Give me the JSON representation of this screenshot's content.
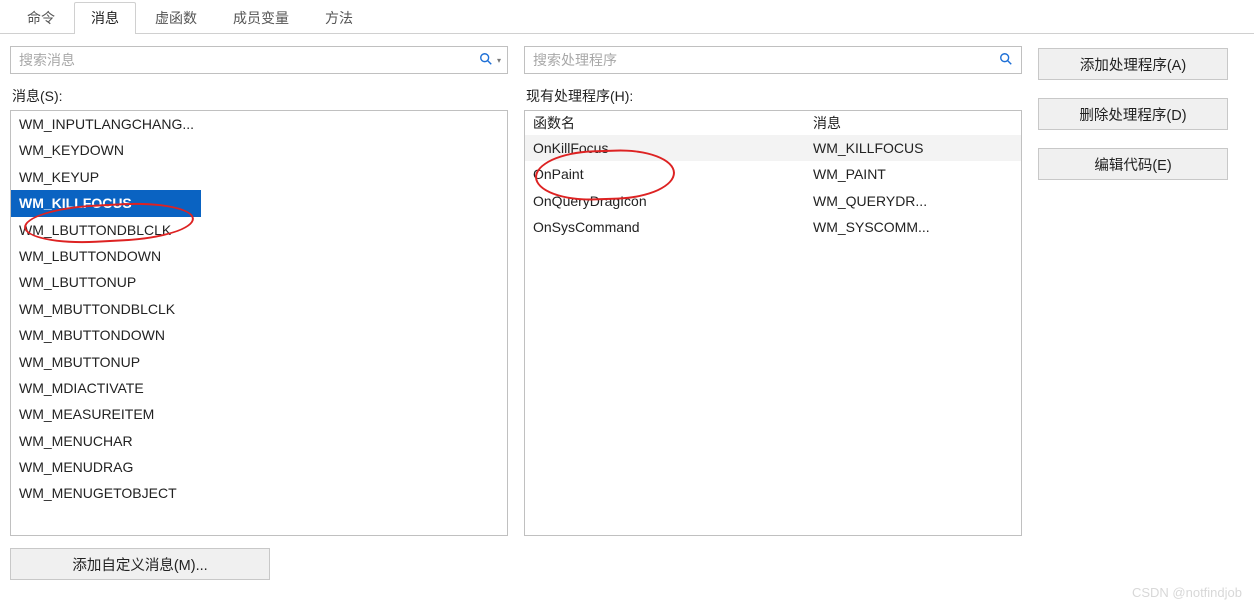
{
  "tabs": {
    "cmd": "命令",
    "msg": "消息",
    "vfunc": "虚函数",
    "memvar": "成员变量",
    "method": "方法"
  },
  "search": {
    "left_placeholder": "搜索消息",
    "right_placeholder": "搜索处理程序"
  },
  "labels": {
    "messages": "消息(S):",
    "handlers": "现有处理程序(H):"
  },
  "messages": [
    "WM_INPUTLANGCHANG...",
    "WM_KEYDOWN",
    "WM_KEYUP",
    "WM_KILLFOCUS",
    "WM_LBUTTONDBLCLK",
    "WM_LBUTTONDOWN",
    "WM_LBUTTONUP",
    "WM_MBUTTONDBLCLK",
    "WM_MBUTTONDOWN",
    "WM_MBUTTONUP",
    "WM_MDIACTIVATE",
    "WM_MEASUREITEM",
    "WM_MENUCHAR",
    "WM_MENUDRAG",
    "WM_MENUGETOBJECT"
  ],
  "messages_selected_index": 3,
  "handler_table": {
    "head_func": "函数名",
    "head_msg": "消息",
    "rows": [
      {
        "func": "OnKillFocus",
        "msg": "WM_KILLFOCUS"
      },
      {
        "func": "OnPaint",
        "msg": "WM_PAINT"
      },
      {
        "func": "OnQueryDragIcon",
        "msg": "WM_QUERYDR..."
      },
      {
        "func": "OnSysCommand",
        "msg": "WM_SYSCOMM..."
      }
    ],
    "selected_index": 0
  },
  "buttons": {
    "add_handler": "添加处理程序(A)",
    "delete_handler": "删除处理程序(D)",
    "edit_code": "编辑代码(E)",
    "add_custom_msg": "添加自定义消息(M)..."
  },
  "watermark": "CSDN @notfindjob"
}
